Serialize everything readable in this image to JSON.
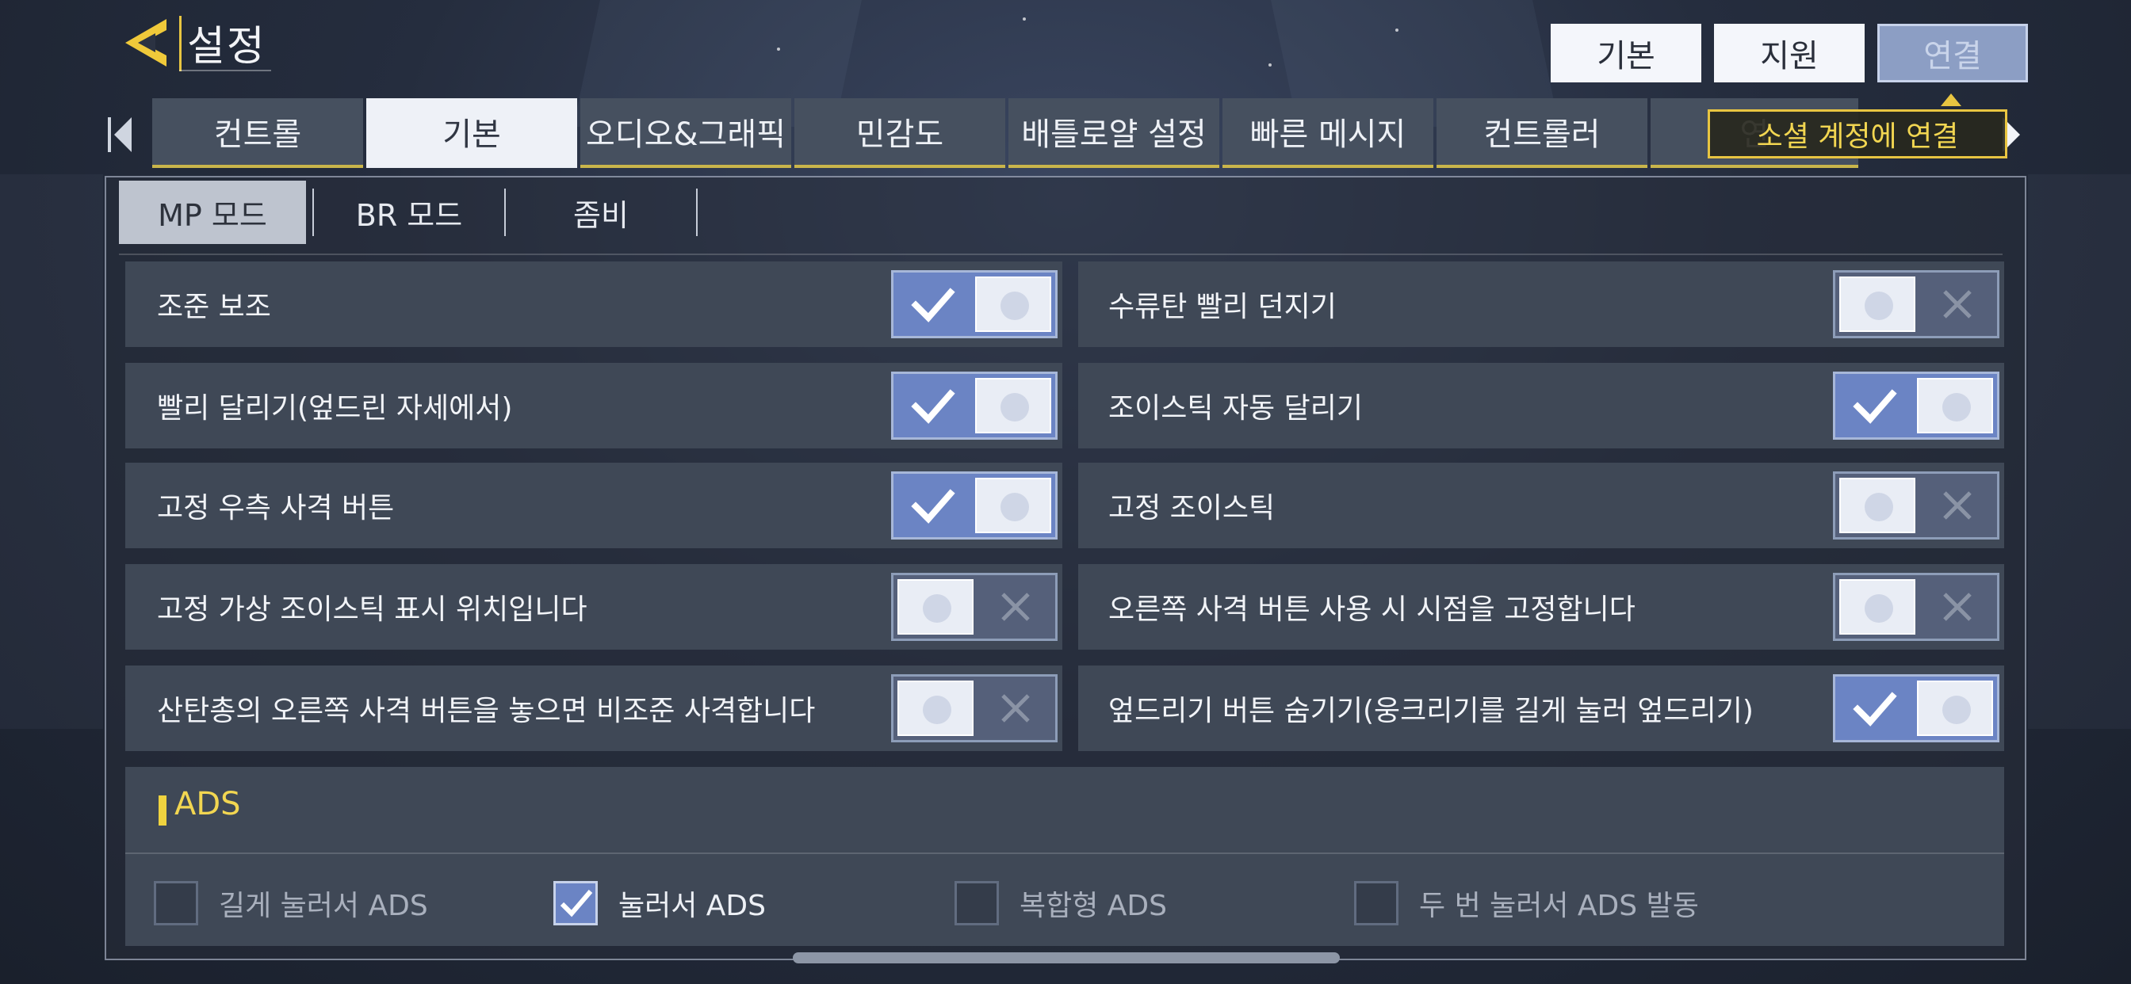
{
  "header": {
    "title": "설정"
  },
  "top_tabs": [
    {
      "label": "기본",
      "active": false
    },
    {
      "label": "지원",
      "active": false
    },
    {
      "label": "연결",
      "active": true
    }
  ],
  "tooltip": "소셜 계정에 연결",
  "category_tabs": [
    {
      "label": "컨트롤",
      "active": false
    },
    {
      "label": "기본",
      "active": true
    },
    {
      "label": "오디오&그래픽",
      "active": false
    },
    {
      "label": "민감도",
      "active": false
    },
    {
      "label": "배틀로얄 설정",
      "active": false
    },
    {
      "label": "빠른 메시지",
      "active": false
    },
    {
      "label": "컨트롤러",
      "active": false
    },
    {
      "label": "연",
      "active": false
    }
  ],
  "sub_tabs": [
    {
      "label": "MP 모드",
      "active": true
    },
    {
      "label": "BR 모드",
      "active": false
    },
    {
      "label": "좀비",
      "active": false
    }
  ],
  "settings_left": [
    {
      "label": "조준 보조",
      "on": true
    },
    {
      "label": "빨리 달리기(엎드린 자세에서)",
      "on": true
    },
    {
      "label": "고정 우측 사격 버튼",
      "on": true
    },
    {
      "label": "고정 가상 조이스틱 표시 위치입니다",
      "on": false
    },
    {
      "label": "산탄총의 오른쪽 사격 버튼을 놓으면 비조준 사격합니다",
      "on": false
    }
  ],
  "settings_right": [
    {
      "label": "수류탄 빨리 던지기",
      "on": false
    },
    {
      "label": "조이스틱 자동 달리기",
      "on": true
    },
    {
      "label": "고정 조이스틱",
      "on": false
    },
    {
      "label": "오른쪽 사격 버튼 사용 시 시점을 고정합니다",
      "on": false
    },
    {
      "label": "엎드리기 버튼 숨기기(웅크리기를 길게 눌러 엎드리기)",
      "on": true
    }
  ],
  "ads": {
    "title": "ADS",
    "options": [
      {
        "label": "길게 눌러서 ADS",
        "checked": false
      },
      {
        "label": "눌러서 ADS",
        "checked": true
      },
      {
        "label": "복합형 ADS",
        "checked": false
      },
      {
        "label": "두 번 눌러서 ADS 발동",
        "checked": false
      }
    ]
  },
  "colors": {
    "accent_yellow": "#e8c541",
    "toggle_on": "#6b84c4",
    "row_bg": "#3f4856"
  }
}
